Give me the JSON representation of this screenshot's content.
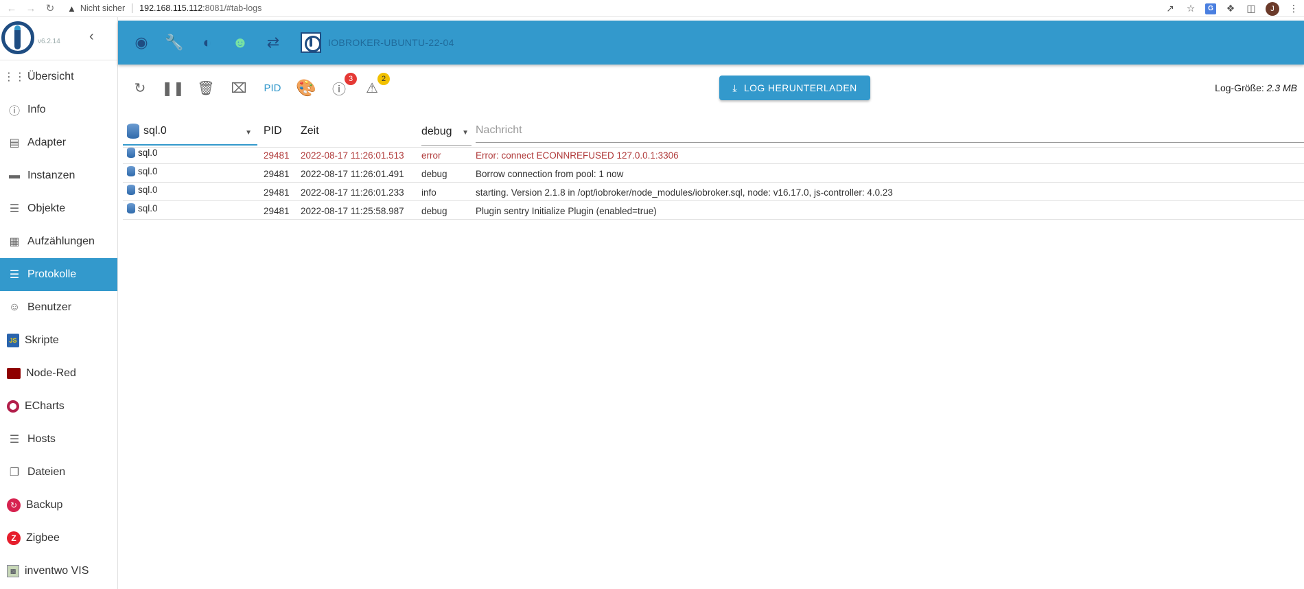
{
  "browser": {
    "insecure_label": "Nicht sicher",
    "url_host": "192.168.115.112",
    "url_path": ":8081/#tab-logs",
    "profile_initial": "J"
  },
  "sidebar": {
    "version": "v6.2.14",
    "items": [
      {
        "label": "Übersicht",
        "icon": "apps-grid-icon"
      },
      {
        "label": "Info",
        "icon": "info-icon"
      },
      {
        "label": "Adapter",
        "icon": "store-icon"
      },
      {
        "label": "Instanzen",
        "icon": "instances-icon"
      },
      {
        "label": "Objekte",
        "icon": "list-icon"
      },
      {
        "label": "Aufzählungen",
        "icon": "enum-icon"
      },
      {
        "label": "Protokolle",
        "icon": "logs-icon",
        "active": true
      },
      {
        "label": "Benutzer",
        "icon": "user-icon"
      },
      {
        "label": "Skripte",
        "icon": "javascript-icon"
      },
      {
        "label": "Node-Red",
        "icon": "node-red-icon"
      },
      {
        "label": "ECharts",
        "icon": "echarts-icon"
      },
      {
        "label": "Hosts",
        "icon": "hosts-icon"
      },
      {
        "label": "Dateien",
        "icon": "files-icon"
      },
      {
        "label": "Backup",
        "icon": "backup-icon"
      },
      {
        "label": "Zigbee",
        "icon": "zigbee-icon"
      },
      {
        "label": "inventwo VIS",
        "icon": "inventwo-icon"
      }
    ]
  },
  "header": {
    "host_name": "IOBROKER-UBUNTU-22-04"
  },
  "toolbar": {
    "pid_label": "PID",
    "error_count": "3",
    "warning_count": "2",
    "download_label": "LOG HERUNTERLADEN",
    "log_size_label": "Log-Größe:",
    "log_size_value": "2.3 MB"
  },
  "table": {
    "source_filter": "sql.0",
    "col_pid": "PID",
    "col_time": "Zeit",
    "level_filter": "debug",
    "message_placeholder": "Nachricht",
    "rows": [
      {
        "source": "sql.0",
        "pid": "29481",
        "time": "2022-08-17 11:26:01.513",
        "level": "error",
        "message": "Error: connect ECONNREFUSED 127.0.0.1:3306"
      },
      {
        "source": "sql.0",
        "pid": "29481",
        "time": "2022-08-17 11:26:01.491",
        "level": "debug",
        "message": "Borrow connection from pool: 1 now"
      },
      {
        "source": "sql.0",
        "pid": "29481",
        "time": "2022-08-17 11:26:01.233",
        "level": "info",
        "message": "starting. Version 2.1.8 in /opt/iobroker/node_modules/iobroker.sql, node: v16.17.0, js-controller: 4.0.23"
      },
      {
        "source": "sql.0",
        "pid": "29481",
        "time": "2022-08-17 11:25:58.987",
        "level": "debug",
        "message": "Plugin sentry Initialize Plugin (enabled=true)"
      }
    ]
  },
  "colors": {
    "accent": "#3399cc",
    "brand_dark": "#1f4d82",
    "error_text": "#b03a3a"
  }
}
